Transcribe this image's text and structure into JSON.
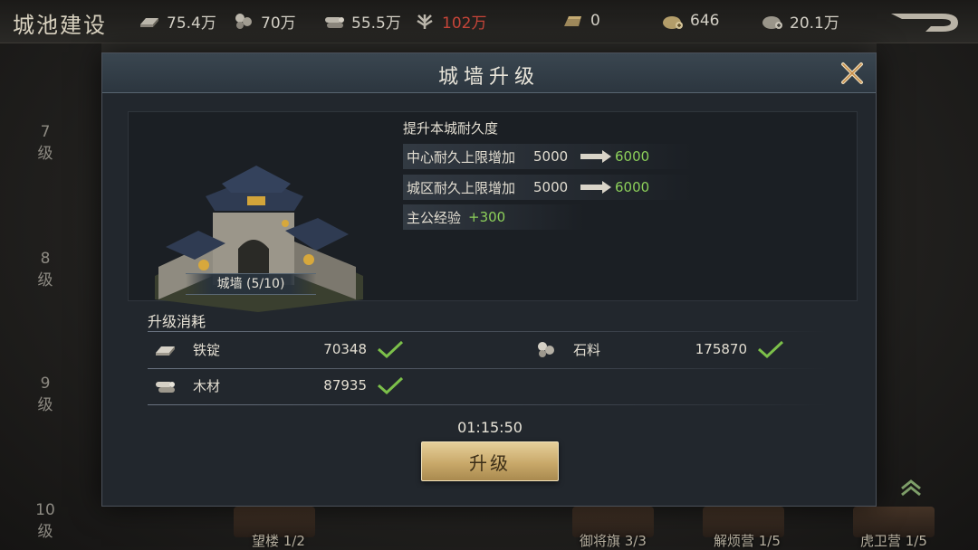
{
  "page": {
    "title": "城池建设",
    "back_icon": "back-arrow-icon"
  },
  "resources": [
    {
      "icon": "iron-ingot-icon",
      "value": "75.4万"
    },
    {
      "icon": "stone-icon",
      "value": "70万"
    },
    {
      "icon": "wood-icon",
      "value": "55.5万"
    },
    {
      "icon": "grain-icon",
      "value": "102万",
      "color": "#c8463a"
    },
    {
      "icon": "gold-bar-icon",
      "value": "0"
    },
    {
      "icon": "coin-bag-icon",
      "value": "646"
    },
    {
      "icon": "silver-bag-icon",
      "value": "20.1万"
    }
  ],
  "levels": [
    {
      "num": "7",
      "unit": "级"
    },
    {
      "num": "8",
      "unit": "级"
    },
    {
      "num": "9",
      "unit": "级"
    },
    {
      "num": "10",
      "unit": "级"
    }
  ],
  "bottom_buildings": [
    "望楼 1/2",
    "御将旗 3/3",
    "解烦营 1/5",
    "虎卫营 1/5"
  ],
  "modal": {
    "title": "城墙升级",
    "close_icon": "close-x-icon",
    "building": {
      "name": "城墙 (5/10)",
      "image": "city-wall-building-image"
    },
    "info_title": "提升本城耐久度",
    "stats": [
      {
        "label": "中心耐久上限增加",
        "from": "5000",
        "to": "6000"
      },
      {
        "label": "城区耐久上限增加",
        "from": "5000",
        "to": "6000"
      }
    ],
    "exp": {
      "label": "主公经验",
      "value": "+300"
    },
    "cost_title": "升级消耗",
    "costs": [
      {
        "icon": "iron-ingot-icon",
        "name": "铁锭",
        "amount": "70348",
        "ok": true
      },
      {
        "icon": "stone-icon",
        "name": "石料",
        "amount": "175870",
        "ok": true
      },
      {
        "icon": "wood-icon",
        "name": "木材",
        "amount": "87935",
        "ok": true
      }
    ],
    "timer": "01:15:50",
    "upgrade_label": "升级"
  },
  "colors": {
    "positive": "#8ccf5a",
    "warning": "#c8463a",
    "gold_button": "#c9a96a"
  }
}
